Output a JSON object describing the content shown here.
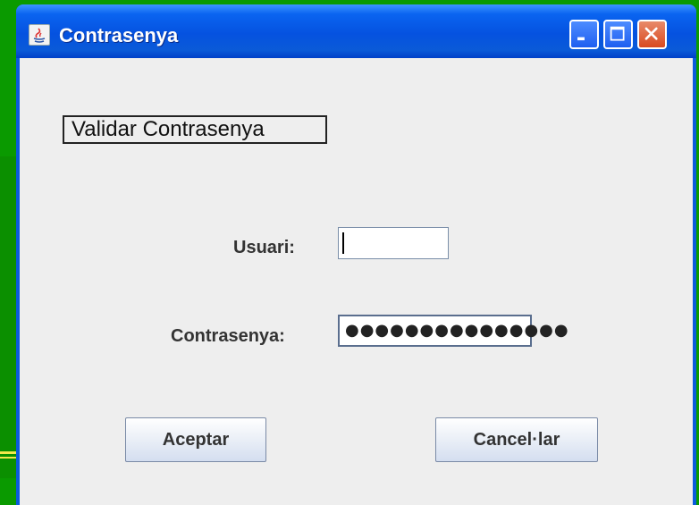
{
  "window": {
    "title": "Contrasenya",
    "icon": "java-icon",
    "controls": [
      "minimize-icon",
      "maximize-icon",
      "close-icon"
    ]
  },
  "form": {
    "heading": "Validar Contrasenya",
    "user_label": "Usuari:",
    "user_value": "",
    "password_label": "Contrasenya:",
    "password_mask": "●●●●●●●●●●●●●●●",
    "accept_label": "Aceptar",
    "cancel_label": "Cancel·lar"
  },
  "colors": {
    "titlebar": "#0552e0",
    "desktop": "#0a9a00",
    "client": "#eeeeee"
  }
}
